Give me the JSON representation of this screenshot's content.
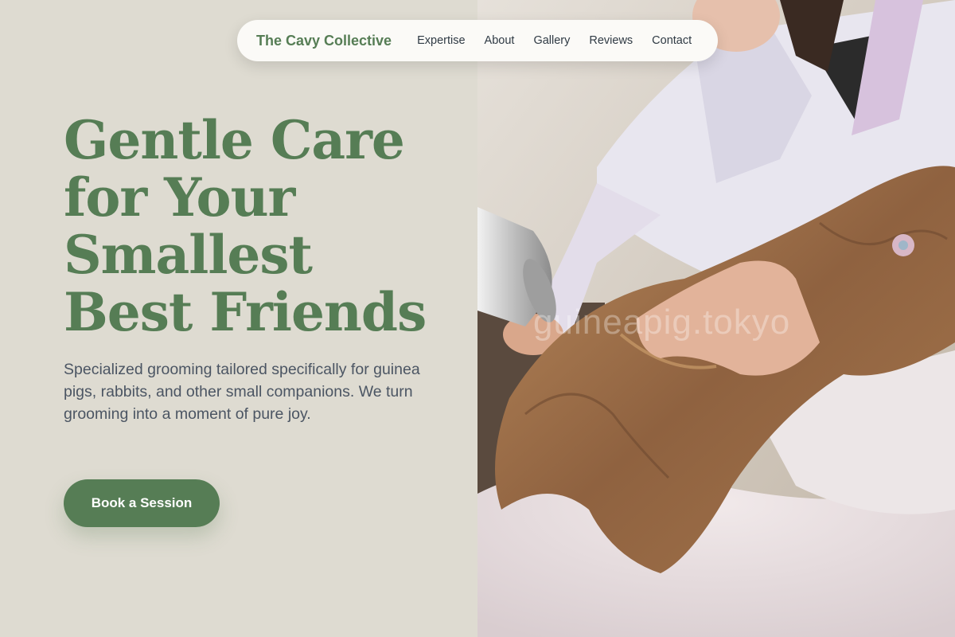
{
  "nav": {
    "brand": "The Cavy Collective",
    "links": [
      "Expertise",
      "About",
      "Gallery",
      "Reviews",
      "Contact"
    ]
  },
  "hero": {
    "title_lines": [
      "Gentle Care",
      "for Your",
      "Smallest",
      "Best Friends"
    ],
    "subtitle": "Specialized grooming tailored specifically for guinea pigs, rabbits, and other small companions. We turn grooming into a moment of pure joy.",
    "cta_label": "Book a Session"
  },
  "photo": {
    "watermark": "guineapig.tokyo"
  },
  "colors": {
    "accent": "#567d55",
    "background": "#dedbd1",
    "nav_bg": "#fbfaf7",
    "text_body": "#4b5563"
  }
}
